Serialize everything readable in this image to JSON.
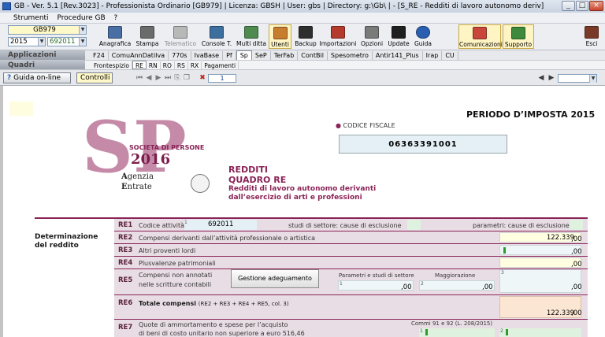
{
  "window": {
    "title": "GB - Ver. 5.1 [Rev.3023]  -  Professionista Ordinario [GB979]    |  Licenza: GBSH | User: gbs | Directory: g:\\Gb\\ |  - [S_RE - Redditi di lavoro autonomo deriv]",
    "buttons": [
      "_",
      "□",
      "×"
    ]
  },
  "menu": [
    "Strumenti",
    "Procedure GB",
    "?"
  ],
  "toolbar": {
    "company_code": "GB979",
    "year": "2015",
    "ditta_code": "692011",
    "buttons": [
      {
        "label": "Anagrafica",
        "icon": "anagrafica-icon",
        "color": "#4a6fa5"
      },
      {
        "label": "Stampa",
        "icon": "printer-icon",
        "color": "#6b6b6b"
      },
      {
        "label": "Telematico",
        "icon": "telematico-icon",
        "color": "#a8a8a8"
      },
      {
        "label": "Console T.",
        "icon": "console-icon",
        "color": "#3d6f9e"
      },
      {
        "label": "Multi ditta",
        "icon": "multi-ditta-icon",
        "color": "#4f8a4f"
      },
      {
        "label": "Utenti",
        "icon": "users-icon",
        "color": "#c77d2e"
      },
      {
        "label": "Backup",
        "icon": "backup-icon",
        "color": "#2e2e2e"
      },
      {
        "label": "Importazioni",
        "icon": "import-icon",
        "color": "#b33a2c"
      },
      {
        "label": "Opzioni",
        "icon": "gear-icon",
        "color": "#7a7a7a"
      },
      {
        "label": "Update",
        "icon": "update-icon",
        "color": "#1f1f1f"
      },
      {
        "label": "Guida",
        "icon": "help-icon",
        "color": "#2a5fb0"
      }
    ],
    "right_buttons": [
      {
        "label": "Comunicazioni",
        "icon": "comunicazioni-icon",
        "color": "#c8463a"
      },
      {
        "label": "Supporto",
        "icon": "supporto-icon",
        "color": "#3d8a3d"
      },
      {
        "label": "Esci",
        "icon": "exit-icon",
        "color": "#7a3a2a"
      }
    ]
  },
  "applicazioni": {
    "label": "Applicazioni",
    "tabs": [
      "F24",
      "ComuAnnDatiIva",
      "770s",
      "IvaBase",
      "Pf",
      "Sp",
      "SeP",
      "TerFab",
      "ContBil",
      "Spesometro",
      "Antir141_Plus",
      "Irap",
      "CU"
    ],
    "active": "Sp"
  },
  "quadri": {
    "label": "Quadri",
    "tabs": [
      "Frontespizio",
      "RE",
      "RN",
      "RO",
      "RS",
      "RX",
      "Pagamenti"
    ],
    "active": "RE"
  },
  "nav": {
    "guida_label": "Guida on-line",
    "controlli_label": "Controlli",
    "page_number": "1"
  },
  "form": {
    "periodo": "PERIODO D’IMPOSTA 2015",
    "codice_fiscale_label": "CODICE FISCALE",
    "codice_fiscale": "06363391001",
    "logo": {
      "letters": "SP",
      "subtitle": "SOCIETÀ DI PERSONE",
      "year": "2016",
      "agenzia": "genzia",
      "entrate": "ntrate"
    },
    "heading": {
      "redditi": "REDDITI",
      "quadro": "QUADRO RE",
      "desc1": "Redditi di lavoro autonomo derivanti",
      "desc2": "dall’esercizio di arti e professioni"
    },
    "section_label": "Determinazione del reddito",
    "re1": {
      "code": "RE1",
      "desc": "Codice attività",
      "value": "692011",
      "studi": "studi di settore: cause di esclusione",
      "parametri": "parametri: cause di esclusione"
    },
    "re2": {
      "code": "RE2",
      "desc": "Compensi derivanti dall’attività professionale o artistica",
      "value": "122.339",
      "dec": ",00"
    },
    "re3": {
      "code": "RE3",
      "desc": "Altri proventi lordi",
      "dec": ",00"
    },
    "re4": {
      "code": "RE4",
      "desc": "Plusvalenze patrimoniali",
      "dec": ",00"
    },
    "re5": {
      "code": "RE5",
      "desc1": "Compensi non annotati",
      "desc2": "nelle scritture contabili",
      "button": "Gestione adeguamento",
      "col1_label": "Parametri e studi di settore",
      "col2_label": "Maggiorazione",
      "dec1": ",00",
      "dec2": ",00",
      "dec3": ",00"
    },
    "re6": {
      "code": "RE6",
      "desc": "Totale compensi",
      "desc_note": "(RE2 + RE3 + RE4 + RE5, col. 3)",
      "value": "122.339",
      "dec": ",00"
    },
    "re7": {
      "code": "RE7",
      "desc1": "Quote di ammortamento e spese per l’acquisto",
      "desc2": "di beni di costo unitario non superiore a euro 516,46",
      "commi": "Commi 91 e 92 (L. 208/2015)"
    }
  }
}
